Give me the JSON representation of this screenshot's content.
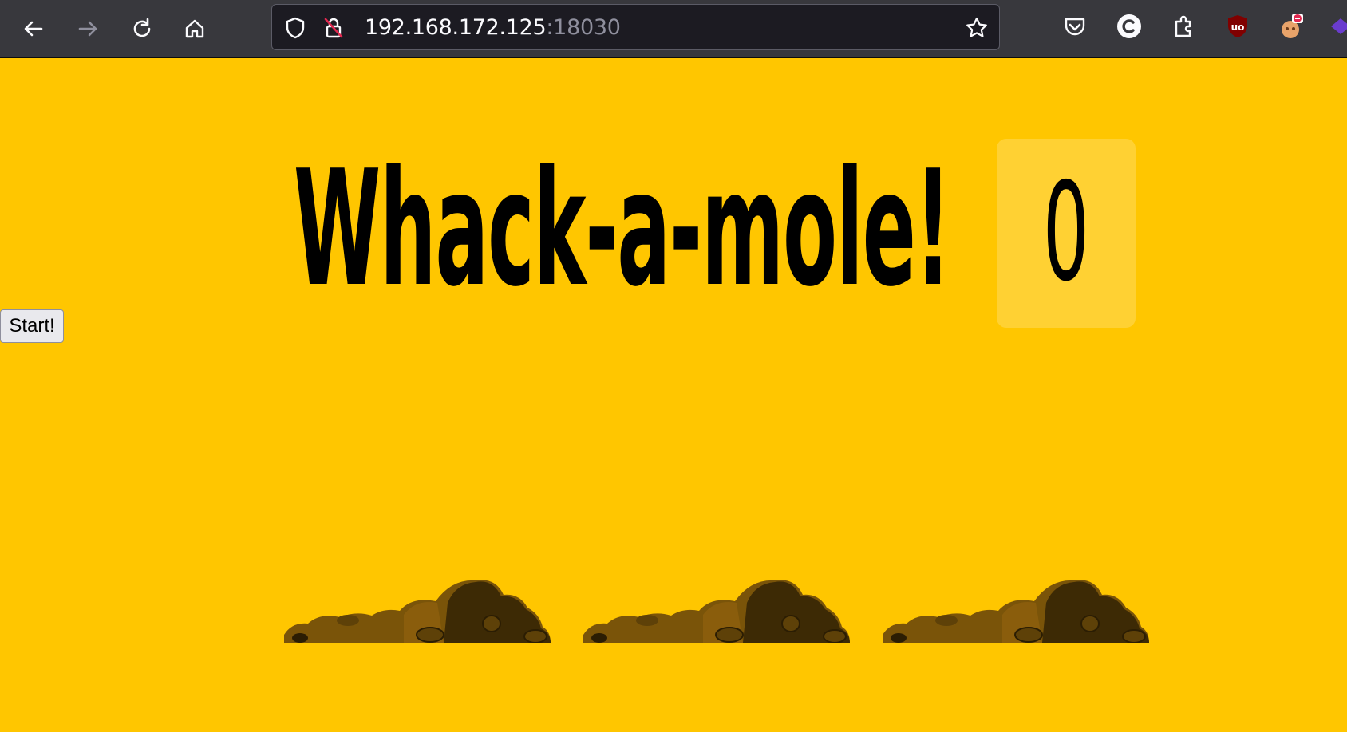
{
  "browser": {
    "url_host": "192.168.172.125",
    "url_port": ":18030",
    "nav_icons": [
      "back-arrow-icon",
      "forward-arrow-icon",
      "reload-icon",
      "home-icon"
    ],
    "urlbar_icons": [
      "tracking-protection-shield-icon",
      "insecure-lock-icon",
      "bookmark-star-icon"
    ],
    "extension_icons": [
      "pocket-icon",
      "c-extension-icon",
      "extensions-puzzle-icon",
      "ublock-origin-icon",
      "blocked-extension-icon",
      "overflow-extension-icon"
    ]
  },
  "game": {
    "title": "Whack-a-mole!",
    "score": "0",
    "start_label": "Start!",
    "holes": [
      "hole-1",
      "hole-2",
      "hole-3"
    ],
    "colors": {
      "background": "#ffc600",
      "dirt_dark": "#3d2a05",
      "dirt_mid": "#6b4a08",
      "dirt_light": "#8a5d0c"
    }
  }
}
